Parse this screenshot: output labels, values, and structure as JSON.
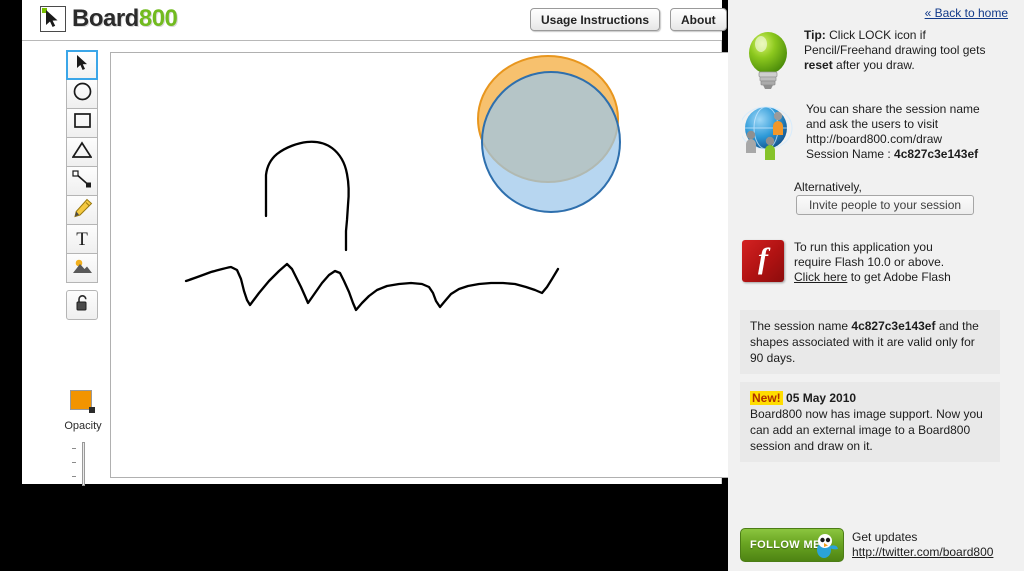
{
  "app": {
    "logo_dark": "Board",
    "logo_green": "800",
    "logo_icon": "cursor-arrow-icon"
  },
  "header": {
    "usage_button": "Usage Instructions",
    "about_button": "About"
  },
  "toolbar": {
    "tools": [
      {
        "name": "select",
        "label": "Select",
        "icon": "cursor-arrow-icon",
        "selected": true
      },
      {
        "name": "circle",
        "label": "Circle",
        "icon": "circle-icon",
        "selected": false
      },
      {
        "name": "rectangle",
        "label": "Rectangle",
        "icon": "square-icon",
        "selected": false
      },
      {
        "name": "triangle",
        "label": "Triangle",
        "icon": "triangle-icon",
        "selected": false
      },
      {
        "name": "line",
        "label": "Line",
        "icon": "line-icon",
        "selected": false
      },
      {
        "name": "pencil",
        "label": "Pencil / Freehand",
        "icon": "pencil-icon",
        "selected": false
      },
      {
        "name": "text",
        "label": "Text",
        "icon": "text-t-icon",
        "selected": false
      },
      {
        "name": "image",
        "label": "Image",
        "icon": "image-icon",
        "selected": false
      },
      {
        "name": "lock",
        "label": "Lock",
        "icon": "open-padlock-icon",
        "selected": false
      }
    ],
    "opacity_label": "Opacity",
    "current_color": "#f29400"
  },
  "canvas": {
    "shapes": [
      {
        "name": "orange-circle",
        "type": "ellipse",
        "fill": "#f5b24a",
        "stroke": "#e8961e",
        "opacity": 0.75
      },
      {
        "name": "blue-circle",
        "type": "ellipse",
        "fill": "#9bc6ea",
        "stroke": "#2e6fad",
        "opacity": 0.75
      },
      {
        "name": "freehand-arch",
        "type": "path",
        "stroke": "#000000"
      },
      {
        "name": "freehand-zigzag",
        "type": "path",
        "stroke": "#000000"
      }
    ]
  },
  "sidebar": {
    "back_home": "« Back to home",
    "tip": {
      "icon": "lightbulb-icon",
      "bold_lead": "Tip:",
      "line1": " Click LOCK icon if",
      "line2": "Pencil/Freehand drawing tool gets",
      "bold_mid": "reset",
      "line3": " after you draw."
    },
    "share": {
      "icon": "globe-people-icon",
      "line1": "You can share the session name",
      "line2": "and ask the users to visit",
      "url": "http://board800.com/draw",
      "session_label": "Session Name : ",
      "session_name": "4c827c3e143ef",
      "alternatively": "Alternatively,",
      "invite_button": "Invite people to your session"
    },
    "flash": {
      "icon": "adobe-flash-icon",
      "glyph": "f",
      "line1": "To run this application you",
      "line2": "require Flash 10.0 or above.",
      "link": "Click here",
      "line3": " to get Adobe Flash"
    },
    "session_notice": {
      "pre": "The session name ",
      "session_name": "4c827c3e143ef",
      "post": " and the shapes associated with it are valid only for 90 days."
    },
    "news": {
      "badge": "New!",
      "date": "05 May 2010",
      "body": "Board800 now has image support. Now you can add an external image to a Board800 session and draw on it."
    },
    "follow": {
      "button_label": "FOLLOW ME",
      "icon": "twitter-bird-icon",
      "line1": "Get updates",
      "url": "http://twitter.com/board800"
    }
  }
}
